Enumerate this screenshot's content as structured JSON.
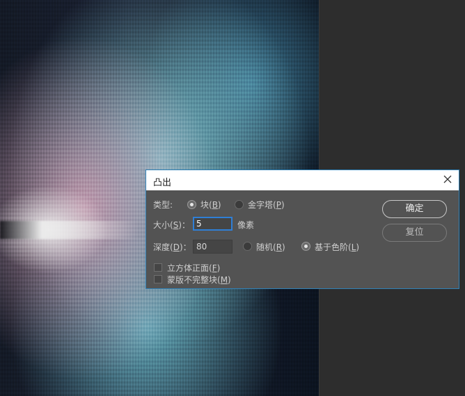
{
  "dialog": {
    "title": "凸出",
    "type_label": "类型:",
    "type_options": [
      {
        "label": "块(",
        "key": "B",
        "selected": true
      },
      {
        "label": "金字塔(",
        "key": "P",
        "selected": false
      }
    ],
    "size_label": "大小(",
    "size_key": "S",
    "size_value": "5",
    "size_unit": "像素",
    "depth_label": "深度(",
    "depth_key": "D",
    "depth_value": "80",
    "depth_options": [
      {
        "label": "随机(",
        "key": "R",
        "selected": false
      },
      {
        "label": "基于色阶(",
        "key": "L",
        "selected": true
      }
    ],
    "checkboxes": [
      {
        "label": "立方体正面(",
        "key": "F",
        "checked": false
      },
      {
        "label": "蒙版不完整块(",
        "key": "M",
        "checked": false
      }
    ],
    "ok_label": "确定",
    "reset_label": "复位"
  },
  "icons": {
    "close": "close-icon"
  },
  "colors": {
    "dialog_bg": "#535353",
    "focus_border": "#2f7fd6",
    "dialog_border": "#2f81b7"
  }
}
